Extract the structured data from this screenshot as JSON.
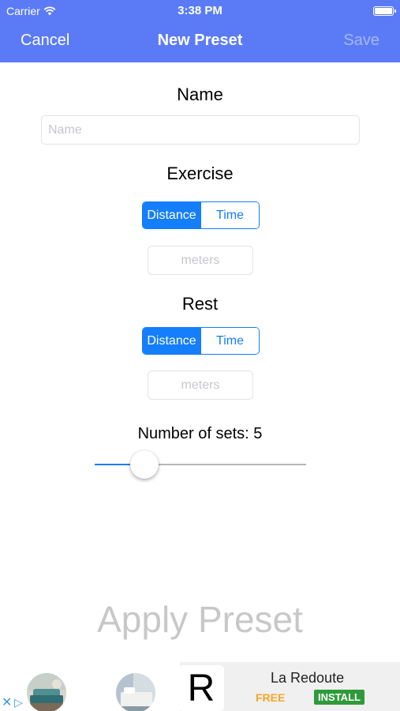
{
  "status_bar": {
    "carrier": "Carrier",
    "time": "3:38 PM"
  },
  "nav": {
    "cancel": "Cancel",
    "title": "New Preset",
    "save": "Save"
  },
  "form": {
    "name_heading": "Name",
    "name_placeholder": "Name",
    "exercise_heading": "Exercise",
    "exercise_segments": [
      "Distance",
      "Time"
    ],
    "exercise_selected": "Distance",
    "exercise_placeholder": "meters",
    "rest_heading": "Rest",
    "rest_segments": [
      "Distance",
      "Time"
    ],
    "rest_selected": "Distance",
    "rest_placeholder": "meters",
    "sets_label": "Number of sets: 5",
    "sets_slider_fraction": 0.235,
    "apply_label": "Apply Preset"
  },
  "ad": {
    "logo_letter": "R",
    "brand": "La Redoute",
    "free": "FREE",
    "install": "INSTALL"
  },
  "colors": {
    "nav": "#5b7bf6",
    "accent": "#157efb",
    "install": "#2e9b3a",
    "free": "#f5a623"
  },
  "icons": [
    "wifi-icon",
    "battery-icon",
    "ad-close-icon",
    "ad-choices-icon"
  ]
}
